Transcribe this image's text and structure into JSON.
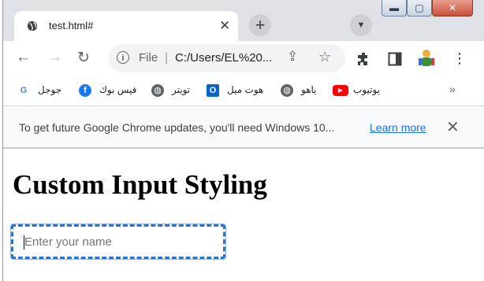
{
  "tab": {
    "title": "test.html#"
  },
  "toolbar": {
    "address_scheme": "File",
    "address_url": "C:/Users/EL%20..."
  },
  "bookmarks": [
    {
      "label": "جوجل",
      "icon": "google-icon",
      "color": "#4285f4"
    },
    {
      "label": "فيس بوك",
      "icon": "facebook-icon",
      "color": "#1877f2"
    },
    {
      "label": "تويتر",
      "icon": "globe-icon",
      "color": "#5f6368"
    },
    {
      "label": "هوت ميل",
      "icon": "outlook-icon",
      "color": "#0a64c8"
    },
    {
      "label": "ياهو",
      "icon": "globe-icon",
      "color": "#5f6368"
    },
    {
      "label": "يوتيوب",
      "icon": "youtube-icon",
      "color": "#ff0000"
    }
  ],
  "infobar": {
    "message": "To get future Google Chrome updates, you'll need Windows 10...",
    "link": "Learn more"
  },
  "page": {
    "heading": "Custom Input Styling",
    "input_placeholder": "Enter your name",
    "input_value": ""
  },
  "colors": {
    "accent": "#2c73c9",
    "link": "#1a73e8"
  }
}
